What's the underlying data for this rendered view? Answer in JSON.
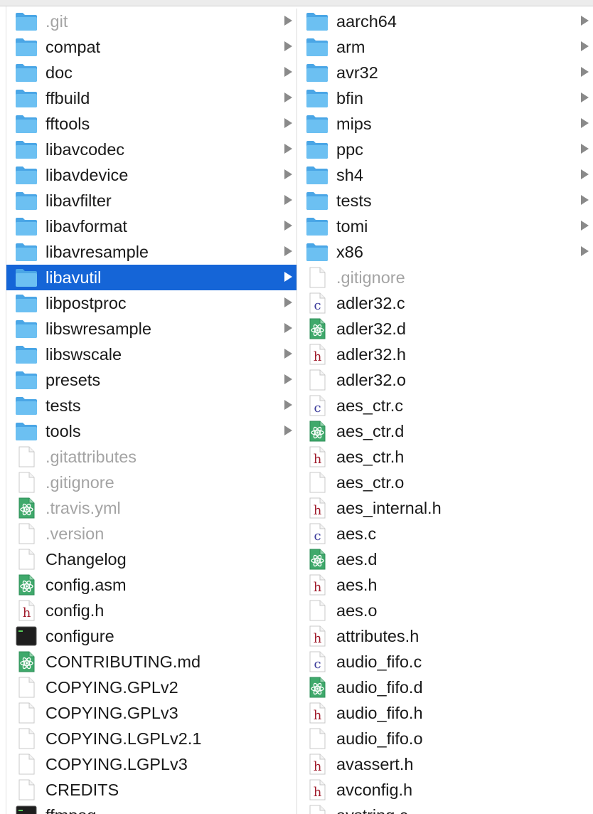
{
  "columns": [
    {
      "items": [
        {
          "name": ".git",
          "kind": "folder",
          "dim": true,
          "selected": false
        },
        {
          "name": "compat",
          "kind": "folder",
          "dim": false,
          "selected": false
        },
        {
          "name": "doc",
          "kind": "folder",
          "dim": false,
          "selected": false
        },
        {
          "name": "ffbuild",
          "kind": "folder",
          "dim": false,
          "selected": false
        },
        {
          "name": "fftools",
          "kind": "folder",
          "dim": false,
          "selected": false
        },
        {
          "name": "libavcodec",
          "kind": "folder",
          "dim": false,
          "selected": false
        },
        {
          "name": "libavdevice",
          "kind": "folder",
          "dim": false,
          "selected": false
        },
        {
          "name": "libavfilter",
          "kind": "folder",
          "dim": false,
          "selected": false
        },
        {
          "name": "libavformat",
          "kind": "folder",
          "dim": false,
          "selected": false
        },
        {
          "name": "libavresample",
          "kind": "folder",
          "dim": false,
          "selected": false
        },
        {
          "name": "libavutil",
          "kind": "folder",
          "dim": false,
          "selected": true
        },
        {
          "name": "libpostproc",
          "kind": "folder",
          "dim": false,
          "selected": false
        },
        {
          "name": "libswresample",
          "kind": "folder",
          "dim": false,
          "selected": false
        },
        {
          "name": "libswscale",
          "kind": "folder",
          "dim": false,
          "selected": false
        },
        {
          "name": "presets",
          "kind": "folder",
          "dim": false,
          "selected": false
        },
        {
          "name": "tests",
          "kind": "folder",
          "dim": false,
          "selected": false
        },
        {
          "name": "tools",
          "kind": "folder",
          "dim": false,
          "selected": false
        },
        {
          "name": ".gitattributes",
          "kind": "doc",
          "dim": true,
          "selected": false
        },
        {
          "name": ".gitignore",
          "kind": "doc",
          "dim": true,
          "selected": false
        },
        {
          "name": ".travis.yml",
          "kind": "atom",
          "dim": true,
          "selected": false
        },
        {
          "name": ".version",
          "kind": "doc",
          "dim": true,
          "selected": false
        },
        {
          "name": "Changelog",
          "kind": "doc",
          "dim": false,
          "selected": false
        },
        {
          "name": "config.asm",
          "kind": "atom",
          "dim": false,
          "selected": false
        },
        {
          "name": "config.h",
          "kind": "h",
          "dim": false,
          "selected": false
        },
        {
          "name": "configure",
          "kind": "exec",
          "dim": false,
          "selected": false
        },
        {
          "name": "CONTRIBUTING.md",
          "kind": "atom",
          "dim": false,
          "selected": false
        },
        {
          "name": "COPYING.GPLv2",
          "kind": "doc",
          "dim": false,
          "selected": false
        },
        {
          "name": "COPYING.GPLv3",
          "kind": "doc",
          "dim": false,
          "selected": false
        },
        {
          "name": "COPYING.LGPLv2.1",
          "kind": "doc",
          "dim": false,
          "selected": false
        },
        {
          "name": "COPYING.LGPLv3",
          "kind": "doc",
          "dim": false,
          "selected": false
        },
        {
          "name": "CREDITS",
          "kind": "doc",
          "dim": false,
          "selected": false
        },
        {
          "name": "ffmpeg",
          "kind": "exec",
          "dim": false,
          "selected": false
        }
      ]
    },
    {
      "items": [
        {
          "name": "aarch64",
          "kind": "folder",
          "dim": false,
          "selected": false
        },
        {
          "name": "arm",
          "kind": "folder",
          "dim": false,
          "selected": false
        },
        {
          "name": "avr32",
          "kind": "folder",
          "dim": false,
          "selected": false
        },
        {
          "name": "bfin",
          "kind": "folder",
          "dim": false,
          "selected": false
        },
        {
          "name": "mips",
          "kind": "folder",
          "dim": false,
          "selected": false
        },
        {
          "name": "ppc",
          "kind": "folder",
          "dim": false,
          "selected": false
        },
        {
          "name": "sh4",
          "kind": "folder",
          "dim": false,
          "selected": false
        },
        {
          "name": "tests",
          "kind": "folder",
          "dim": false,
          "selected": false
        },
        {
          "name": "tomi",
          "kind": "folder",
          "dim": false,
          "selected": false
        },
        {
          "name": "x86",
          "kind": "folder",
          "dim": false,
          "selected": false
        },
        {
          "name": ".gitignore",
          "kind": "doc",
          "dim": true,
          "selected": false
        },
        {
          "name": "adler32.c",
          "kind": "c",
          "dim": false,
          "selected": false
        },
        {
          "name": "adler32.d",
          "kind": "atom",
          "dim": false,
          "selected": false
        },
        {
          "name": "adler32.h",
          "kind": "h",
          "dim": false,
          "selected": false
        },
        {
          "name": "adler32.o",
          "kind": "doc",
          "dim": false,
          "selected": false
        },
        {
          "name": "aes_ctr.c",
          "kind": "c",
          "dim": false,
          "selected": false
        },
        {
          "name": "aes_ctr.d",
          "kind": "atom",
          "dim": false,
          "selected": false
        },
        {
          "name": "aes_ctr.h",
          "kind": "h",
          "dim": false,
          "selected": false
        },
        {
          "name": "aes_ctr.o",
          "kind": "doc",
          "dim": false,
          "selected": false
        },
        {
          "name": "aes_internal.h",
          "kind": "h",
          "dim": false,
          "selected": false
        },
        {
          "name": "aes.c",
          "kind": "c",
          "dim": false,
          "selected": false
        },
        {
          "name": "aes.d",
          "kind": "atom",
          "dim": false,
          "selected": false
        },
        {
          "name": "aes.h",
          "kind": "h",
          "dim": false,
          "selected": false
        },
        {
          "name": "aes.o",
          "kind": "doc",
          "dim": false,
          "selected": false
        },
        {
          "name": "attributes.h",
          "kind": "h",
          "dim": false,
          "selected": false
        },
        {
          "name": "audio_fifo.c",
          "kind": "c",
          "dim": false,
          "selected": false
        },
        {
          "name": "audio_fifo.d",
          "kind": "atom",
          "dim": false,
          "selected": false
        },
        {
          "name": "audio_fifo.h",
          "kind": "h",
          "dim": false,
          "selected": false
        },
        {
          "name": "audio_fifo.o",
          "kind": "doc",
          "dim": false,
          "selected": false
        },
        {
          "name": "avassert.h",
          "kind": "h",
          "dim": false,
          "selected": false
        },
        {
          "name": "avconfig.h",
          "kind": "h",
          "dim": false,
          "selected": false
        },
        {
          "name": "avstring.c",
          "kind": "c",
          "dim": false,
          "selected": false
        }
      ]
    }
  ],
  "icon_glyphs": {
    "c": "c",
    "h": "h"
  },
  "colors": {
    "selection": "#1565d7",
    "folder": "#5fb7ee",
    "dim_text": "#a4a4a4",
    "c_letter": "#3a3a9a",
    "h_letter": "#a01c2c",
    "atom_bg": "#3fa96b"
  }
}
